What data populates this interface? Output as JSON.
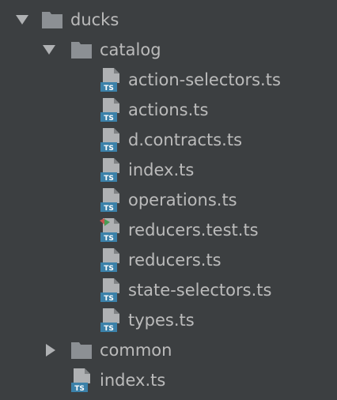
{
  "tree": {
    "root": {
      "label": "ducks",
      "expanded": true,
      "icon": "folder-icon"
    },
    "catalog": {
      "label": "catalog",
      "expanded": true,
      "icon": "folder-icon",
      "files": [
        {
          "label": "action-selectors.ts",
          "icon": "typescript-file-icon"
        },
        {
          "label": "actions.ts",
          "icon": "typescript-file-icon"
        },
        {
          "label": "d.contracts.ts",
          "icon": "typescript-file-icon"
        },
        {
          "label": "index.ts",
          "icon": "typescript-file-icon"
        },
        {
          "label": "operations.ts",
          "icon": "typescript-file-icon"
        },
        {
          "label": "reducers.test.ts",
          "icon": "typescript-test-file-icon"
        },
        {
          "label": "reducers.ts",
          "icon": "typescript-file-icon"
        },
        {
          "label": "state-selectors.ts",
          "icon": "typescript-file-icon"
        },
        {
          "label": "types.ts",
          "icon": "typescript-file-icon"
        }
      ]
    },
    "common": {
      "label": "common",
      "expanded": false,
      "icon": "folder-icon"
    },
    "root_index": {
      "label": "index.ts",
      "icon": "typescript-file-icon"
    }
  },
  "colors": {
    "background": "#3c3f41",
    "text": "#bbbbbb",
    "folder": "#8c9094",
    "file_page": "#afb1b3",
    "ts_badge": "#3b81a9",
    "test_green": "#499c54",
    "test_red": "#c75450"
  }
}
